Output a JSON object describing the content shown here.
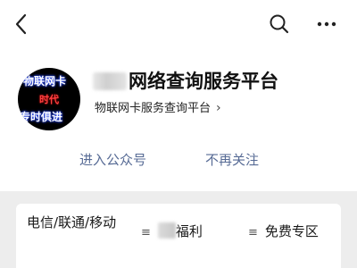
{
  "topbar": {
    "back_icon": "chevron-left-icon",
    "search_icon": "search-icon",
    "more_icon": "more-dots-icon"
  },
  "account": {
    "avatar_text": [
      "物联网卡",
      "时代",
      "专时俱进"
    ],
    "name": "网络查询服务平台",
    "subtitle": "物联网卡服务查询平台",
    "subtitle_chevron": "›"
  },
  "actions": {
    "enter": "进入公众号",
    "unfollow": "不再关注"
  },
  "menu": {
    "items": [
      {
        "label": "电信/联通/移动"
      },
      {
        "label": "福利"
      },
      {
        "label": "免费专区"
      }
    ],
    "hamburger_icon": "≡"
  },
  "colors": {
    "link": "#576b95",
    "divider_bg": "#ededed"
  }
}
